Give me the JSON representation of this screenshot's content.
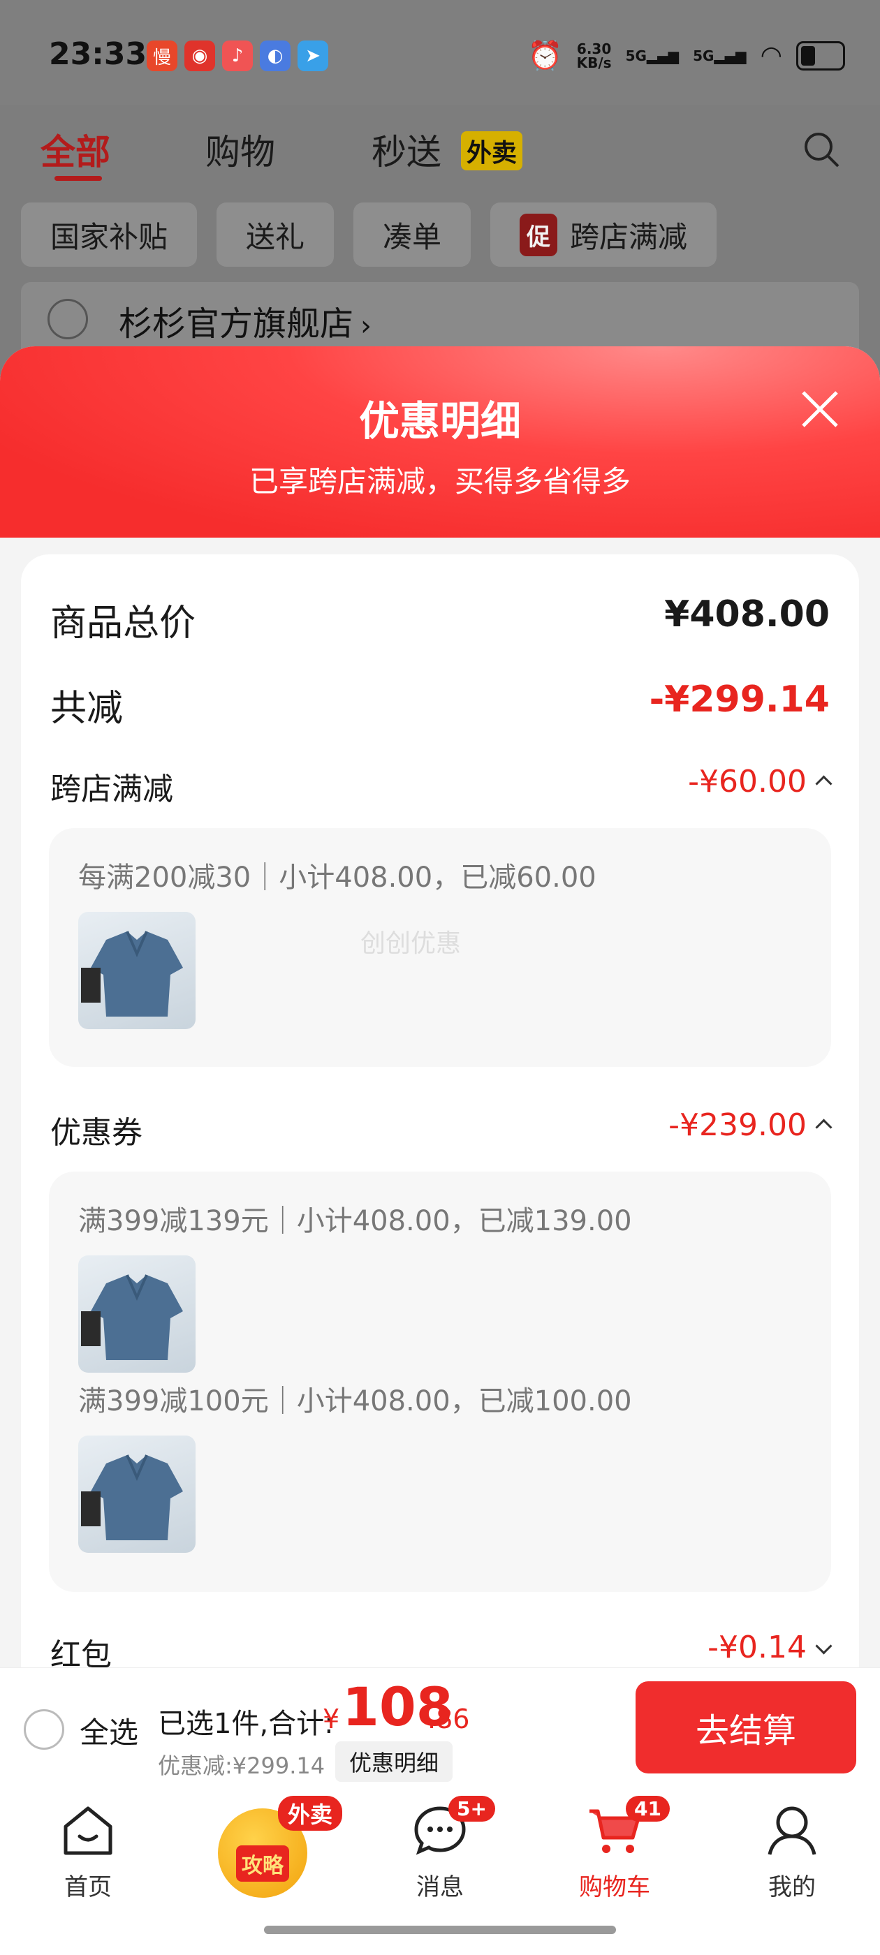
{
  "status_bar": {
    "time": "23:33",
    "net_speed_top": "6.30",
    "net_speed_unit": "KB/s",
    "sig1": "5G",
    "sig2": "5G"
  },
  "cart_bg": {
    "tabs": [
      "全部",
      "购物",
      "秒送"
    ],
    "waimai_badge": "外卖",
    "chips": [
      "国家补贴",
      "送礼",
      "凑单",
      "跨店满减"
    ],
    "chip_promo": "促",
    "shop_name": "杉杉官方旗舰店",
    "shop_arrow": "›"
  },
  "sheet": {
    "title": "优惠明细",
    "subtitle": "已享跨店满减，买得多省得多",
    "total_label": "商品总价",
    "total_value": "¥408.00",
    "reduce_label": "共减",
    "reduce_value": "-¥299.14",
    "cross_label": "跨店满减",
    "cross_value": "-¥60.00",
    "cross_detail": "每满200减30｜小计408.00，已减60.00",
    "watermark": "创创优惠",
    "coupon_label": "优惠券",
    "coupon_value": "-¥239.00",
    "coupon_detail_1": "满399减139元｜小计408.00，已减139.00",
    "coupon_detail_2": "满399减100元｜小计408.00，已减100.00",
    "redpacket_label": "红包",
    "redpacket_value": "-¥0.14"
  },
  "paybar": {
    "select_all": "全选",
    "selected_total_label": "已选1件,合计:",
    "yen": "¥",
    "total_int": "108",
    "total_dec": ".86",
    "discount_label": "优惠减:¥299.14",
    "discount_btn": "优惠明细",
    "checkout": "去结算"
  },
  "nav": {
    "home": "首页",
    "gonglue": "攻略",
    "gonglue_badge": "外卖",
    "messages": "消息",
    "messages_badge": "5+",
    "cart": "购物车",
    "cart_badge": "41",
    "me": "我的"
  },
  "colors": {
    "accent": "#e8251f",
    "sheet_header": "#f62d2d"
  }
}
